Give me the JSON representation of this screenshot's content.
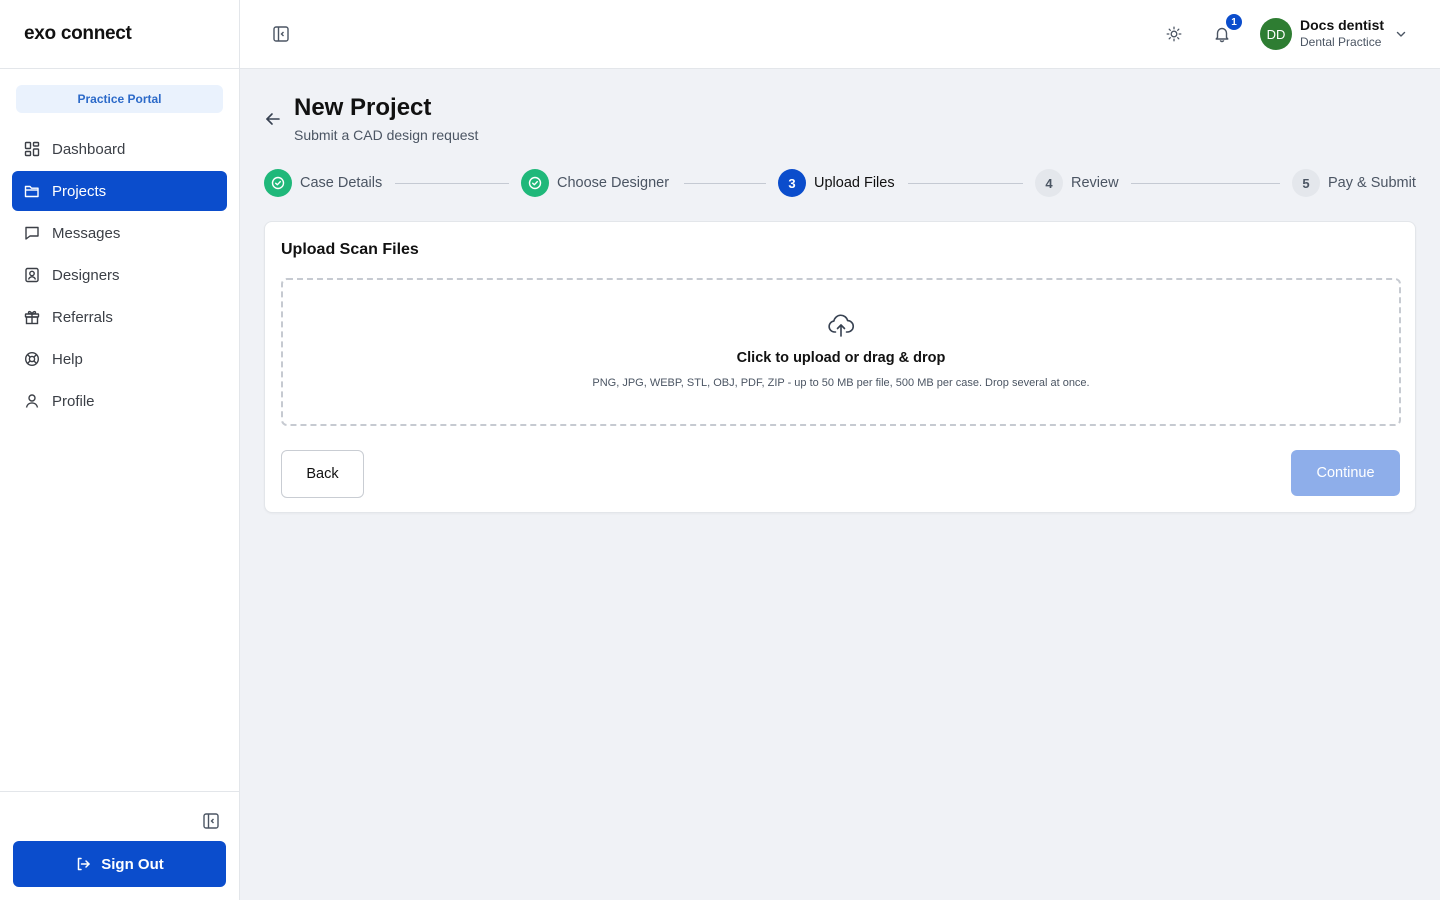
{
  "sidebar": {
    "logo": "exo connect",
    "portal_label": "Practice Portal",
    "items": [
      {
        "label": "Dashboard",
        "icon": "dashboard-icon"
      },
      {
        "label": "Projects",
        "icon": "folder-icon",
        "active": true
      },
      {
        "label": "Messages",
        "icon": "message-icon"
      },
      {
        "label": "Designers",
        "icon": "designer-badge-icon"
      },
      {
        "label": "Referrals",
        "icon": "gift-icon"
      },
      {
        "label": "Help",
        "icon": "lifebuoy-icon"
      },
      {
        "label": "Profile",
        "icon": "user-icon"
      }
    ],
    "signout_label": "Sign Out"
  },
  "header": {
    "notification_count": "1",
    "user": {
      "initials": "DD",
      "name": "Docs dentist",
      "role": "Dental Practice"
    }
  },
  "page": {
    "title": "New Project",
    "subtitle": "Submit a CAD design request"
  },
  "stepper": {
    "steps": [
      {
        "number": "1",
        "label": "Case Details",
        "state": "done"
      },
      {
        "number": "2",
        "label": "Choose Designer",
        "state": "done"
      },
      {
        "number": "3",
        "label": "Upload Files",
        "state": "current"
      },
      {
        "number": "4",
        "label": "Review",
        "state": "pending"
      },
      {
        "number": "5",
        "label": "Pay & Submit",
        "state": "pending"
      }
    ]
  },
  "upload": {
    "title": "Upload Scan Files",
    "dropzone_title": "Click to upload or drag & drop",
    "dropzone_hint": "PNG, JPG, WEBP, STL, OBJ, PDF, ZIP - up to 50 MB per file, 500 MB per case. Drop several at once.",
    "back_label": "Back",
    "continue_label": "Continue",
    "continue_disabled": true
  },
  "colors": {
    "primary": "#0b4dcc",
    "success": "#1fb87a",
    "avatar": "#2e7d32",
    "disabled_primary": "#8eaeea"
  }
}
